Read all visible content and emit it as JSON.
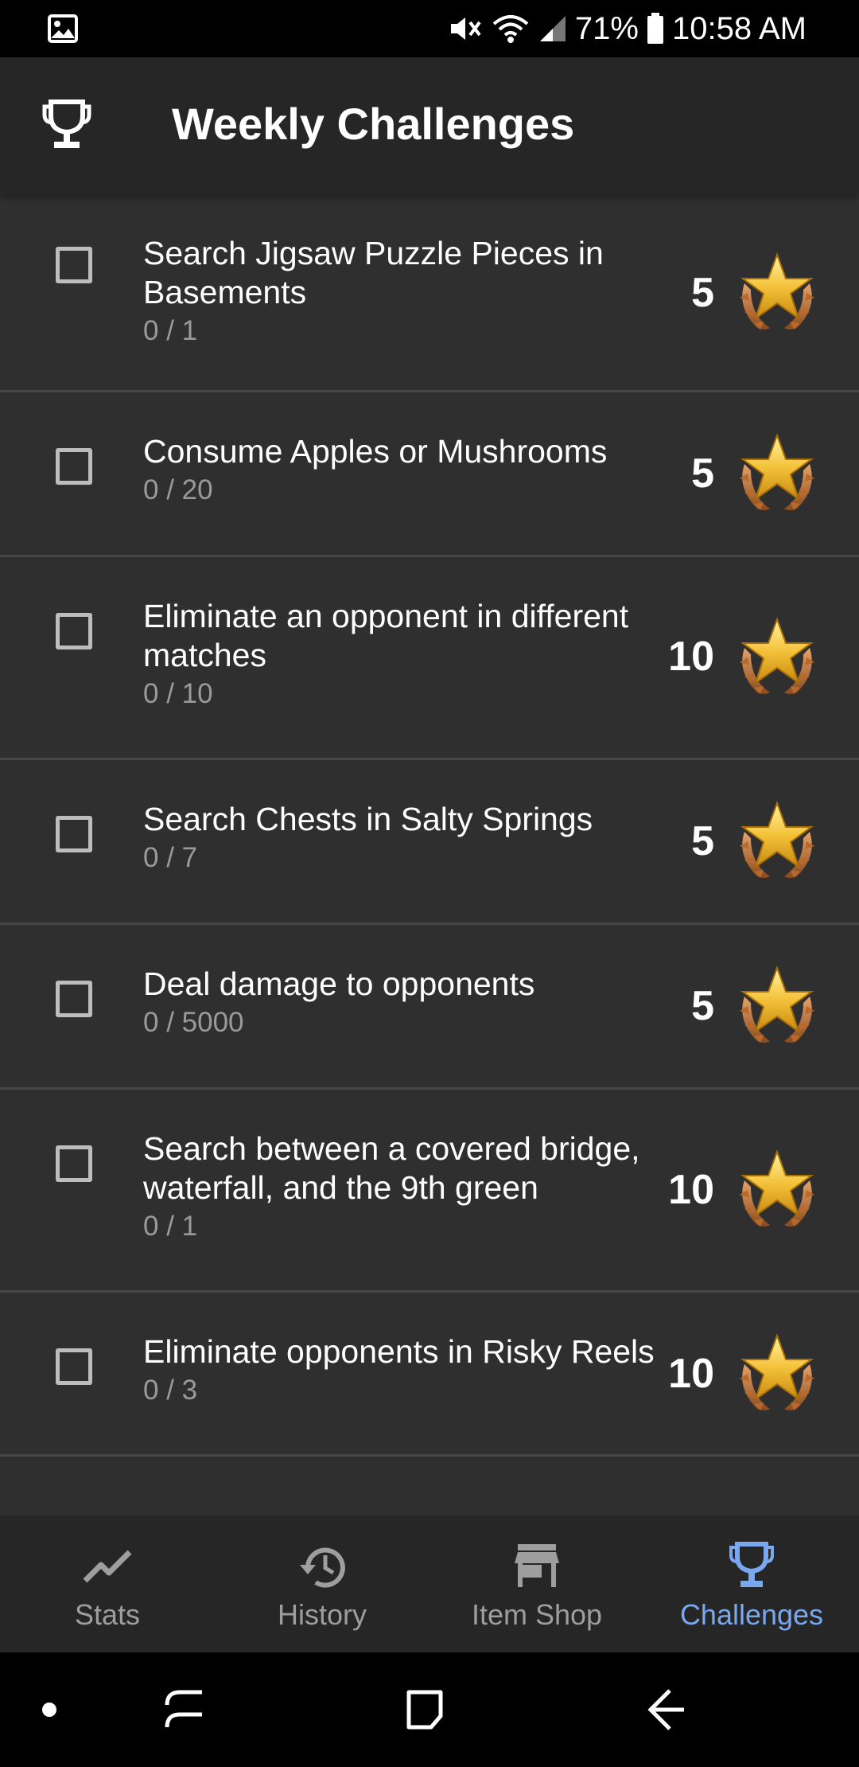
{
  "status_bar": {
    "battery": "71%",
    "time": "10:58 AM"
  },
  "header": {
    "title": "Weekly Challenges",
    "icon": "trophy-icon"
  },
  "challenges": [
    {
      "title": "Search Jigsaw Puzzle Pieces in Basements",
      "progress": "0 / 1",
      "reward": "5"
    },
    {
      "title": "Consume Apples or Mushrooms",
      "progress": "0 / 20",
      "reward": "5"
    },
    {
      "title": "Eliminate an opponent in different matches",
      "progress": "0 / 10",
      "reward": "10"
    },
    {
      "title": "Search Chests in Salty Springs",
      "progress": "0 / 7",
      "reward": "5"
    },
    {
      "title": "Deal damage to opponents",
      "progress": "0 / 5000",
      "reward": "5"
    },
    {
      "title": "Search between a covered bridge, waterfall, and the 9th green",
      "progress": "0 / 1",
      "reward": "10"
    },
    {
      "title": "Eliminate opponents in Risky Reels",
      "progress": "0 / 3",
      "reward": "10"
    }
  ],
  "bottom_nav": {
    "items": [
      {
        "label": "Stats",
        "icon": "trending-up-icon"
      },
      {
        "label": "History",
        "icon": "history-icon"
      },
      {
        "label": "Item Shop",
        "icon": "store-icon"
      },
      {
        "label": "Challenges",
        "icon": "trophy-icon"
      }
    ],
    "active_index": 3
  },
  "colors": {
    "background": "#2f2f2f",
    "app_bar": "#262626",
    "active_nav": "#7aa8ee",
    "divider": "#474747"
  }
}
